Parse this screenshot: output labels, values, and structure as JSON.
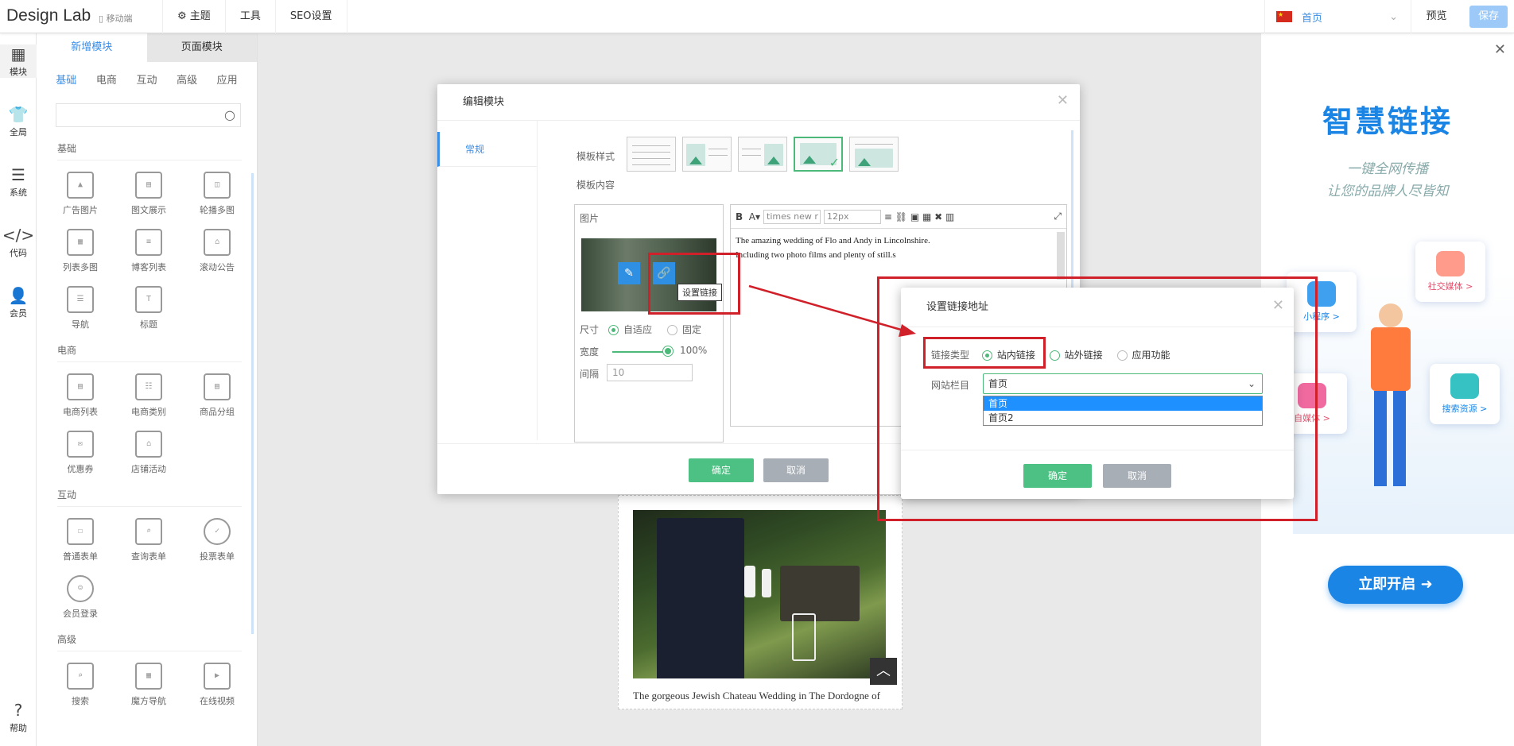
{
  "topbar": {
    "brand": "Design Lab",
    "mobile_label": "移动端",
    "nav": [
      {
        "label": "主题",
        "icon": "theme-icon"
      },
      {
        "label": "工具"
      },
      {
        "label": "SEO设置"
      }
    ],
    "lang_label": "首页",
    "preview_label": "预览",
    "save_label": "保存"
  },
  "iconbar": [
    {
      "label": "模块",
      "icon": "modules-icon"
    },
    {
      "label": "全局",
      "icon": "shirt-icon"
    },
    {
      "label": "系统",
      "icon": "document-icon"
    },
    {
      "label": "代码",
      "icon": "code-icon"
    },
    {
      "label": "会员",
      "icon": "user-icon"
    },
    {
      "label": "帮助",
      "icon": "help-icon"
    }
  ],
  "panel": {
    "tabs": [
      "新增模块",
      "页面模块"
    ],
    "subtabs": [
      "基础",
      "电商",
      "互动",
      "高级",
      "应用"
    ],
    "search_placeholder": "",
    "sections": [
      {
        "title": "基础",
        "items": [
          "广告图片",
          "图文展示",
          "轮播多图",
          "列表多图",
          "博客列表",
          "滚动公告",
          "导航",
          "标题"
        ]
      },
      {
        "title": "电商",
        "items": [
          "电商列表",
          "电商类别",
          "商品分组",
          "优惠券",
          "店铺活动"
        ]
      },
      {
        "title": "互动",
        "items": [
          "普通表单",
          "查询表单",
          "投票表单",
          "会员登录"
        ]
      },
      {
        "title": "高级",
        "items": [
          "搜索",
          "魔方导航",
          "在线视频"
        ]
      }
    ]
  },
  "ad": {
    "title": "智慧链接",
    "sub1": "一键全网传播",
    "sub2": "让您的品牌人尽皆知",
    "cards": [
      "小程序 >",
      "社交媒体 >",
      "自媒体 >",
      "搜索资源 >"
    ],
    "cta": "立即开启"
  },
  "preview": {
    "caption": "The gorgeous Jewish Chateau Wedding in The Dordogne of"
  },
  "edit_dialog": {
    "title": "编辑模块",
    "side_tab": "常规",
    "template_style_label": "模板样式",
    "template_content_label": "模板内容",
    "image_label": "图片",
    "tooltip": "设置链接",
    "size_label": "尺寸",
    "size_opt1": "自适应",
    "size_opt2": "固定",
    "width_label": "宽度",
    "width_value": "100%",
    "width_fraction": 1.0,
    "spacing_label": "间隔",
    "spacing_value": "10",
    "font_select": "times new r",
    "size_select": "12px",
    "editor_line1": "The amazing wedding of Flo and Andy in Lincolnshire.",
    "editor_line2": "Including two photo films and plenty of still.s",
    "ok": "确定",
    "cancel": "取消"
  },
  "link_dialog": {
    "title": "设置链接地址",
    "type_label": "链接类型",
    "types": [
      "站内链接",
      "站外链接",
      "应用功能"
    ],
    "column_label": "网站栏目",
    "selected": "首页",
    "options": [
      "首页",
      "首页2"
    ],
    "ok": "确定",
    "cancel": "取消"
  },
  "colors": {
    "accent": "#3a8ee6",
    "green": "#4cc183",
    "annotation": "#d0202a"
  }
}
